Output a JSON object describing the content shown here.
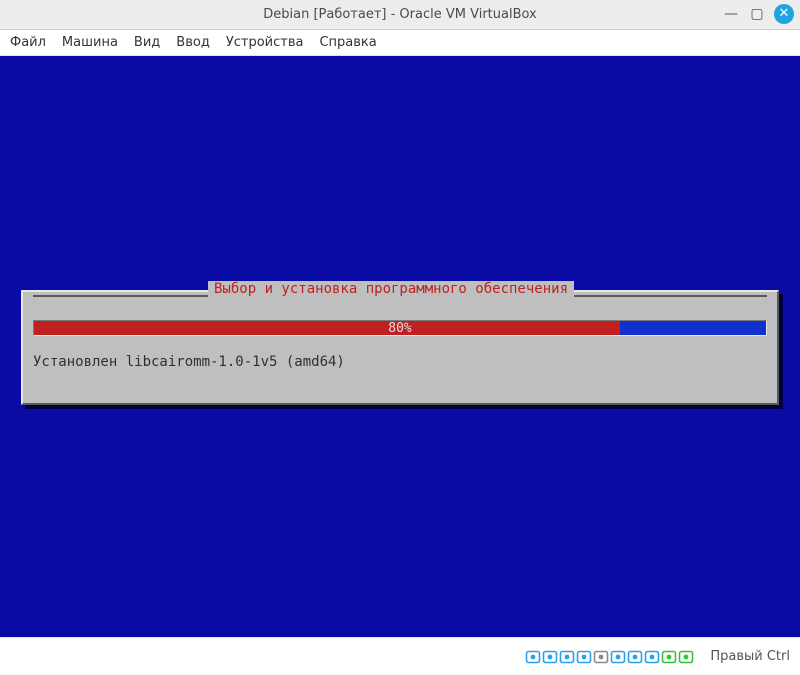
{
  "titlebar": {
    "title": "Debian [Работает] - Oracle VM VirtualBox",
    "minimize_glyph": "—",
    "maximize_glyph": "▢",
    "close_glyph": "✕"
  },
  "menu": {
    "items": [
      "Файл",
      "Машина",
      "Вид",
      "Ввод",
      "Устройства",
      "Справка"
    ]
  },
  "installer": {
    "dialog_title": "Выбор и установка программного обеспечения",
    "progress_percent": 80,
    "progress_label": "80%",
    "status_line": "Установлен libcairomm-1.0-1v5 (amd64)"
  },
  "statusbar": {
    "hostkey_label": "Правый Ctrl",
    "icons": [
      {
        "name": "hdd-icon",
        "color": "#2aa0e8"
      },
      {
        "name": "optical-icon",
        "color": "#2aa0e8"
      },
      {
        "name": "network-icon",
        "color": "#2aa0e8"
      },
      {
        "name": "usb-icon",
        "color": "#2aa0e8"
      },
      {
        "name": "shared-folder-icon",
        "color": "#8a8a8a"
      },
      {
        "name": "display-icon",
        "color": "#2aa0e8"
      },
      {
        "name": "recording-icon",
        "color": "#2aa0e8"
      },
      {
        "name": "clipboard-icon",
        "color": "#2aa0e8"
      },
      {
        "name": "mouse-integration-icon",
        "color": "#36c23a"
      },
      {
        "name": "hostkey-status-icon",
        "color": "#36c23a"
      }
    ]
  }
}
